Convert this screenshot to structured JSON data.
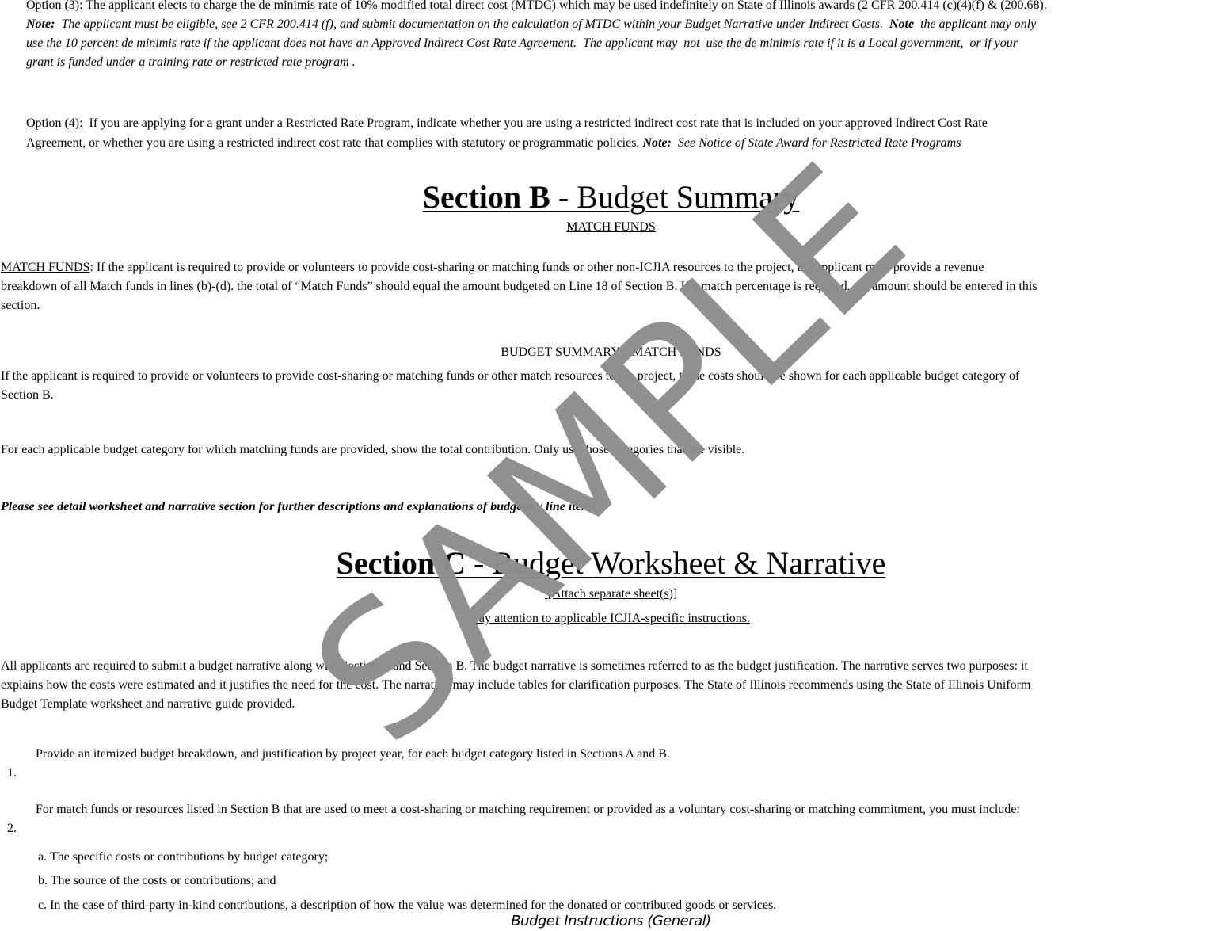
{
  "option3": {
    "label": "Option (3)",
    "text": ": The applicant elects to charge the de minimis rate of 10% modified total direct cost (MTDC) which may be used indefinitely on State of Illinois awards (2 CFR 200.414 (c)(4)(f) & (200.68).",
    "note_label": "Note:",
    "note_line1": "  The applicant must be eligible, see 2 CFR 200.414 (f), and submit documentation on the calculation of MTDC within your Budget Narrative under Indirect Costs.  ",
    "note2_label": "Note",
    "note_line1_end": "  the applicant may only",
    "note_line2_a": "use the 10 percent de minimis rate if the applicant does not have an Approved Indirect Cost Rate Agreement.  The applicant may  ",
    "note_line2_not": "not",
    "note_line2_b": "  use the de minimis rate if it is a Local government,  or if your",
    "note_line3": "grant is funded under a training rate or restricted rate program ."
  },
  "option4": {
    "label": "Option (4):",
    "line1": "  If you are applying for a grant under a Restricted Rate Program, indicate whether you are using a restricted indirect cost rate that is included on your approved Indirect Cost Rate",
    "line2": "Agreement, or whether you are using a restricted indirect cost rate that complies with statutory or programmatic policies. ",
    "note_label": "Note:",
    "note_text": "  See Notice of State Award for Restricted Rate Programs"
  },
  "section_b": {
    "title_bold": "Section B",
    "title_rest": " - Budget Summary",
    "subtitle": "MATCH FUNDS",
    "match_label": "MATCH FUNDS",
    "match_line1": ": If the applicant is required to provide or volunteers to provide cost-sharing or matching funds or other non-ICJIA resources to the project, the applicant must provide a revenue",
    "match_line2": "breakdown of all Match funds in lines (b)-(d). the total of “Match Funds” should equal the amount budgeted on Line 18 of Section B. If a match percentage is required, the amount should be entered in this",
    "match_line3": "section.",
    "summary_heading_a": "BUDGET SUMMARY –",
    "summary_heading_u": " MATCH",
    "summary_heading_b": " FUNDS",
    "summary_line1": "If the applicant is required to provide or volunteers to provide cost-sharing or matching funds or other match resources to the project, these costs should be shown for each applicable budget category of",
    "summary_line2": "Section B.",
    "each_category": "For each applicable budget category for which matching funds are provided, show the total contribution. Only use those categories that are visible.",
    "please_see": "Please see detail worksheet and narrative section for further descriptions and explanations of budgetary line items"
  },
  "section_c": {
    "title_bold": "Section C",
    "title_rest": " - Budget Worksheet & Narrative",
    "attach": " [Attach separate sheet(s)]",
    "pay_attention": "Pay attention to applicable ICJIA-specific instructions.",
    "intro_line1": "All applicants are required to submit a budget narrative along with Section A and Section B. The budget narrative is sometimes referred to as the budget justification. The narrative serves two purposes: it",
    "intro_line2": "explains how the costs were estimated and it justifies the need for the cost. The narrative may include tables for clarification purposes. The State of Illinois recommends using the State of Illinois Uniform",
    "intro_line3": "Budget Template worksheet and narrative guide provided.",
    "items": [
      {
        "num": "1.",
        "text": "Provide an itemized budget breakdown, and justification by project year, for each budget category listed in Sections A and B."
      },
      {
        "num": "2.",
        "text": "For match funds or resources listed in Section B that are used to meet a cost-sharing or matching requirement or provided as a voluntary cost-sharing or matching commitment, you must include:"
      }
    ],
    "subitems": [
      "a. The specific costs or contributions by budget category;",
      "b. The source of the costs or contributions; and",
      "c. In the case of third-party in-kind contributions, a description of how the value was determined for the donated or contributed goods or services."
    ]
  },
  "footer": "Budget Instructions (General)",
  "watermark": "SAMPLE"
}
